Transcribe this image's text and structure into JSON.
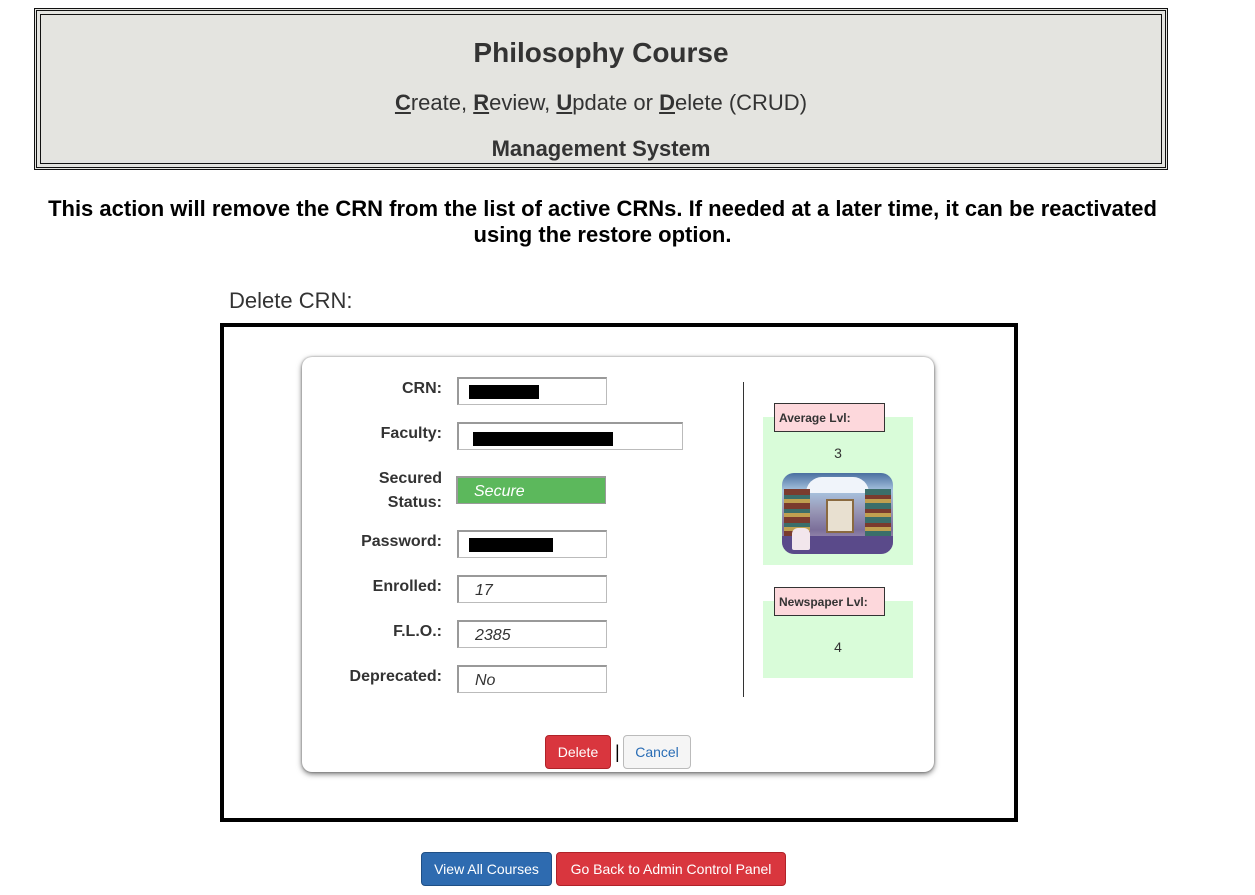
{
  "header": {
    "title": "Philosophy Course",
    "crud_letters": [
      "C",
      "R",
      "U",
      "D"
    ],
    "crud_rest": [
      "reate, ",
      "eview, ",
      "pdate or ",
      "elete (CRUD)"
    ],
    "subtitle": "Management System"
  },
  "warning": "This action will remove the CRN from the list of active CRNs. If needed at a later time, it can be reactivated using the restore option.",
  "section_label": "Delete CRN:",
  "form": {
    "crn_label": "CRN:",
    "faculty_label": "Faculty:",
    "secured_label_line1": "Secured",
    "secured_label_line2": "Status:",
    "secured_value": "Secure",
    "password_label": "Password:",
    "enrolled_label": "Enrolled:",
    "enrolled_value": "17",
    "flo_label": "F.L.O.:",
    "flo_value": "2385",
    "deprecated_label": "Deprecated:",
    "deprecated_value": "No"
  },
  "levels": {
    "average_label": "Average Lvl:",
    "average_value": "3",
    "newspaper_label": "Newspaper Lvl:",
    "newspaper_value": "4"
  },
  "buttons": {
    "delete": "Delete",
    "separator": "|",
    "cancel": "Cancel",
    "view_all": "View All Courses",
    "go_back": "Go Back to Admin Control Panel"
  },
  "colors": {
    "header_bg": "#e4e4e0",
    "secure_green": "#5cb85c",
    "panel_green": "#d9fcd9",
    "label_pink": "#fdd8dc",
    "danger_red": "#d9363e",
    "primary_blue": "#2e6bb0"
  }
}
